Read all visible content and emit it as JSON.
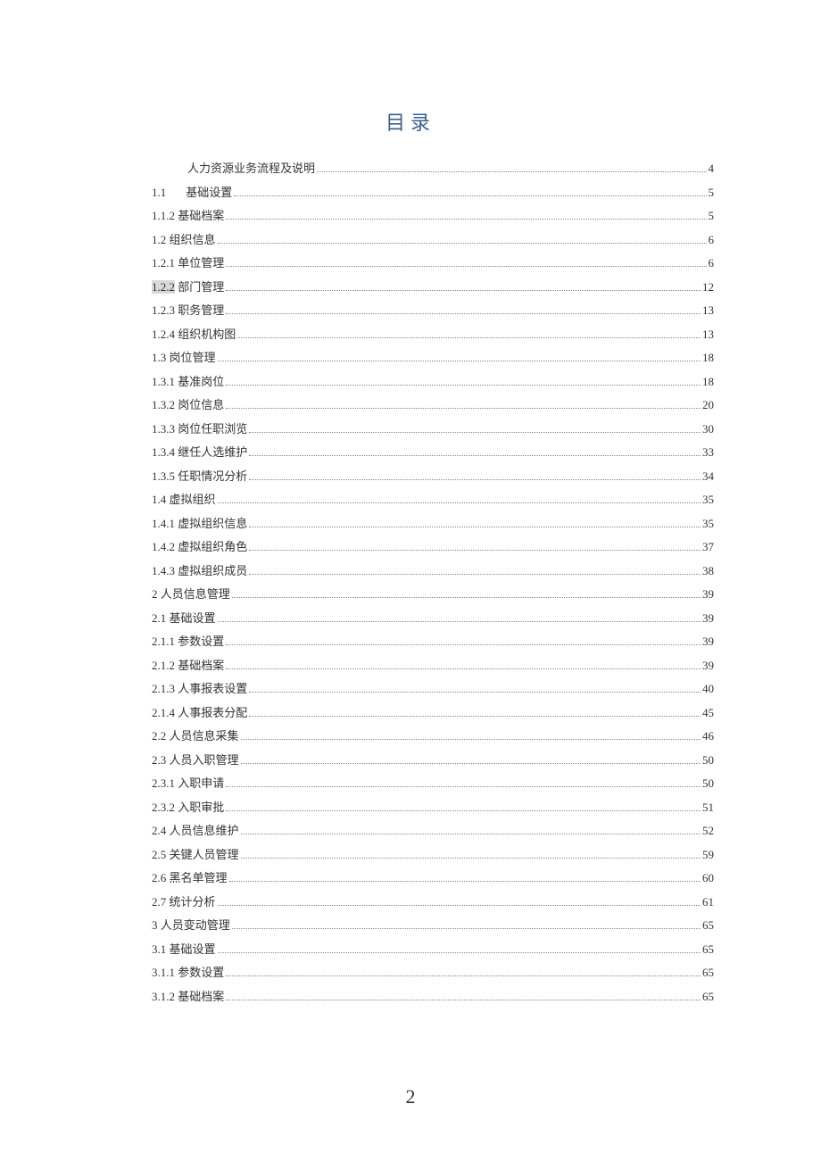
{
  "title": "目录",
  "page_number": "2",
  "toc": [
    {
      "num": "",
      "text": "人力资源业务流程及说明",
      "page": "4",
      "indent": true
    },
    {
      "num": "1.1",
      "text": "基础设置",
      "page": "5",
      "gap": true
    },
    {
      "num": "1.1.2",
      "text": "基础档案",
      "page": "5"
    },
    {
      "num": "1.2",
      "text": "组织信息",
      "page": "6"
    },
    {
      "num": "1.2.1",
      "text": "单位管理",
      "page": "6"
    },
    {
      "num": "1.2.2",
      "text": "部门管理",
      "page": "12",
      "highlight": true
    },
    {
      "num": "1.2.3",
      "text": "职务管理",
      "page": "13"
    },
    {
      "num": "1.2.4",
      "text": "组织机构图",
      "page": "13"
    },
    {
      "num": "1.3",
      "text": "岗位管理",
      "page": "18"
    },
    {
      "num": "1.3.1",
      "text": "基准岗位",
      "page": "18"
    },
    {
      "num": "1.3.2",
      "text": "岗位信息",
      "page": "20"
    },
    {
      "num": "1.3.3",
      "text": "岗位任职浏览",
      "page": "30"
    },
    {
      "num": "1.3.4",
      "text": "继任人选维护",
      "page": "33"
    },
    {
      "num": "1.3.5",
      "text": "任职情况分析",
      "page": "34"
    },
    {
      "num": "1.4",
      "text": "虚拟组织",
      "page": "35"
    },
    {
      "num": "1.4.1",
      "text": "虚拟组织信息",
      "page": "35"
    },
    {
      "num": "1.4.2",
      "text": "虚拟组织角色",
      "page": "37"
    },
    {
      "num": "1.4.3",
      "text": "虚拟组织成员",
      "page": "38"
    },
    {
      "num": "2",
      "text": "人员信息管理",
      "page": "39"
    },
    {
      "num": "2.1",
      "text": "基础设置",
      "page": "39"
    },
    {
      "num": "2.1.1",
      "text": "参数设置",
      "page": "39"
    },
    {
      "num": "2.1.2",
      "text": "基础档案",
      "page": "39"
    },
    {
      "num": "2.1.3",
      "text": "人事报表设置",
      "page": "40"
    },
    {
      "num": "2.1.4",
      "text": "人事报表分配",
      "page": "45"
    },
    {
      "num": "2.2",
      "text": "人员信息采集",
      "page": "46"
    },
    {
      "num": "2.3",
      "text": "人员入职管理",
      "page": "50"
    },
    {
      "num": "2.3.1",
      "text": "入职申请",
      "page": "50"
    },
    {
      "num": "2.3.2",
      "text": "入职审批",
      "page": "51"
    },
    {
      "num": "2.4",
      "text": "人员信息维护",
      "page": "52"
    },
    {
      "num": "2.5",
      "text": "关键人员管理",
      "page": "59"
    },
    {
      "num": "2.6",
      "text": "黑名单管理",
      "page": "60"
    },
    {
      "num": "2.7",
      "text": "统计分析",
      "page": "61"
    },
    {
      "num": "3",
      "text": "人员变动管理",
      "page": "65"
    },
    {
      "num": "3.1",
      "text": "基础设置",
      "page": "65"
    },
    {
      "num": "3.1.1",
      "text": "参数设置",
      "page": "65"
    },
    {
      "num": "3.1.2",
      "text": "基础档案",
      "page": "65"
    }
  ]
}
